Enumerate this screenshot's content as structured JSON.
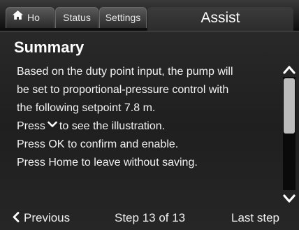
{
  "tabs": {
    "home_label": "Ho",
    "status_label": "Status",
    "settings_label": "Settings",
    "active_label": "Assist"
  },
  "page": {
    "title": "Summary"
  },
  "content": {
    "line1": "Based on the duty point input, the pump will",
    "line2": "be set to proportional-pressure control with",
    "line3": "the following setpoint  7.8 m.",
    "line4_before": "Press",
    "line4_after": "to see the illustration.",
    "line5": "Press OK to confirm and enable.",
    "line6": "Press Home to leave without saving."
  },
  "scrollbar": {
    "position": 0.0,
    "thumb_fraction": 0.5
  },
  "footer": {
    "previous_label": "Previous",
    "step_label": "Step 13 of 13",
    "next_label": "Last step"
  },
  "colors": {
    "background": "#262626",
    "text": "#ffffff",
    "scroll_thumb": "#bdbdbd"
  },
  "icons": {
    "home": "home-icon",
    "inline_down": "chevron-down-icon",
    "scroll_up": "scroll-up-arrow-icon",
    "scroll_down": "scroll-down-arrow-icon",
    "previous": "chevron-left-icon"
  }
}
